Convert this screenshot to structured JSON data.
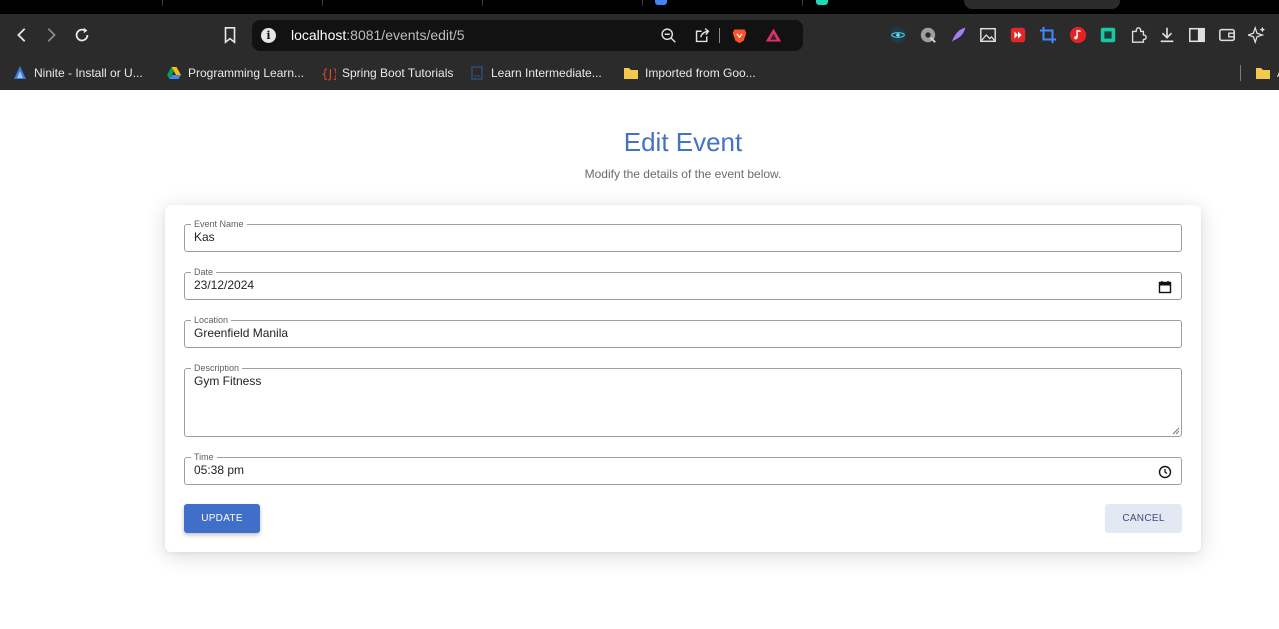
{
  "browser": {
    "url_host": "localhost",
    "url_path": ":8081/events/edit/5",
    "bookmarks": [
      {
        "label": "Ninite - Install or U...",
        "icon": "ninite-icon"
      },
      {
        "label": "Programming Learn...",
        "icon": "google-drive-icon"
      },
      {
        "label": "Spring Boot Tutorials",
        "icon": "javaguides-icon"
      },
      {
        "label": "Learn Intermediate...",
        "icon": "document-icon"
      },
      {
        "label": "Imported from Goo...",
        "icon": "folder-icon"
      }
    ],
    "overflow_bookmark_letter": "A",
    "colors": {
      "chrome_bg": "#2b2b2b",
      "tabstrip_bg": "#000000",
      "omnibox_bg": "#121212"
    }
  },
  "page": {
    "title": "Edit Event",
    "subtitle": "Modify the details of the event below."
  },
  "form": {
    "event_name": {
      "label": "Event Name",
      "value": "Kas"
    },
    "date": {
      "label": "Date",
      "value": "23/12/2024",
      "icon": "calendar-icon"
    },
    "location": {
      "label": "Location",
      "value": "Greenfield Manila"
    },
    "description": {
      "label": "Description",
      "value": "Gym Fitness"
    },
    "time": {
      "label": "Time",
      "value": "05:38 pm",
      "icon": "clock-icon"
    },
    "update_label": "UPDATE",
    "cancel_label": "CANCEL"
  },
  "colors": {
    "accent": "#4472c4",
    "update_button": "#3f6fc9",
    "cancel_button": "#e3e9f3"
  }
}
